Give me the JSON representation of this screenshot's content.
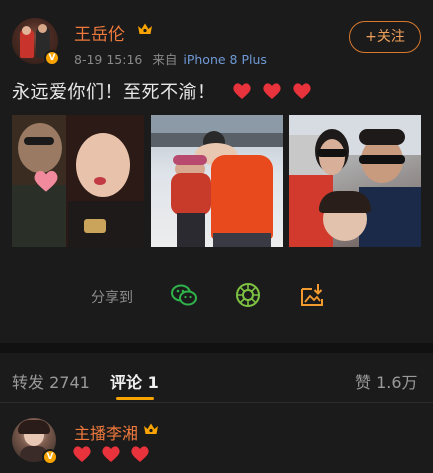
{
  "post": {
    "author": "王岳伦",
    "date": "8-19 15:16",
    "source_prefix": "来自",
    "source": "iPhone 8 Plus",
    "follow_label": "+关注",
    "text": "永远爱你们！至死不渝！",
    "verified_mark": "V"
  },
  "share": {
    "label": "分享到",
    "icons": [
      "wechat-icon",
      "moments-icon",
      "save-image-icon"
    ]
  },
  "tabs": {
    "repost": "转发 2741",
    "comment": "评论 1",
    "like": "赞 1.6万"
  },
  "comment": {
    "author": "主播李湘",
    "verified_mark": "V"
  },
  "colors": {
    "accent": "#f0793c",
    "badge": "#f7a400",
    "heart": "#e8323c",
    "link": "#6f9ad6"
  }
}
